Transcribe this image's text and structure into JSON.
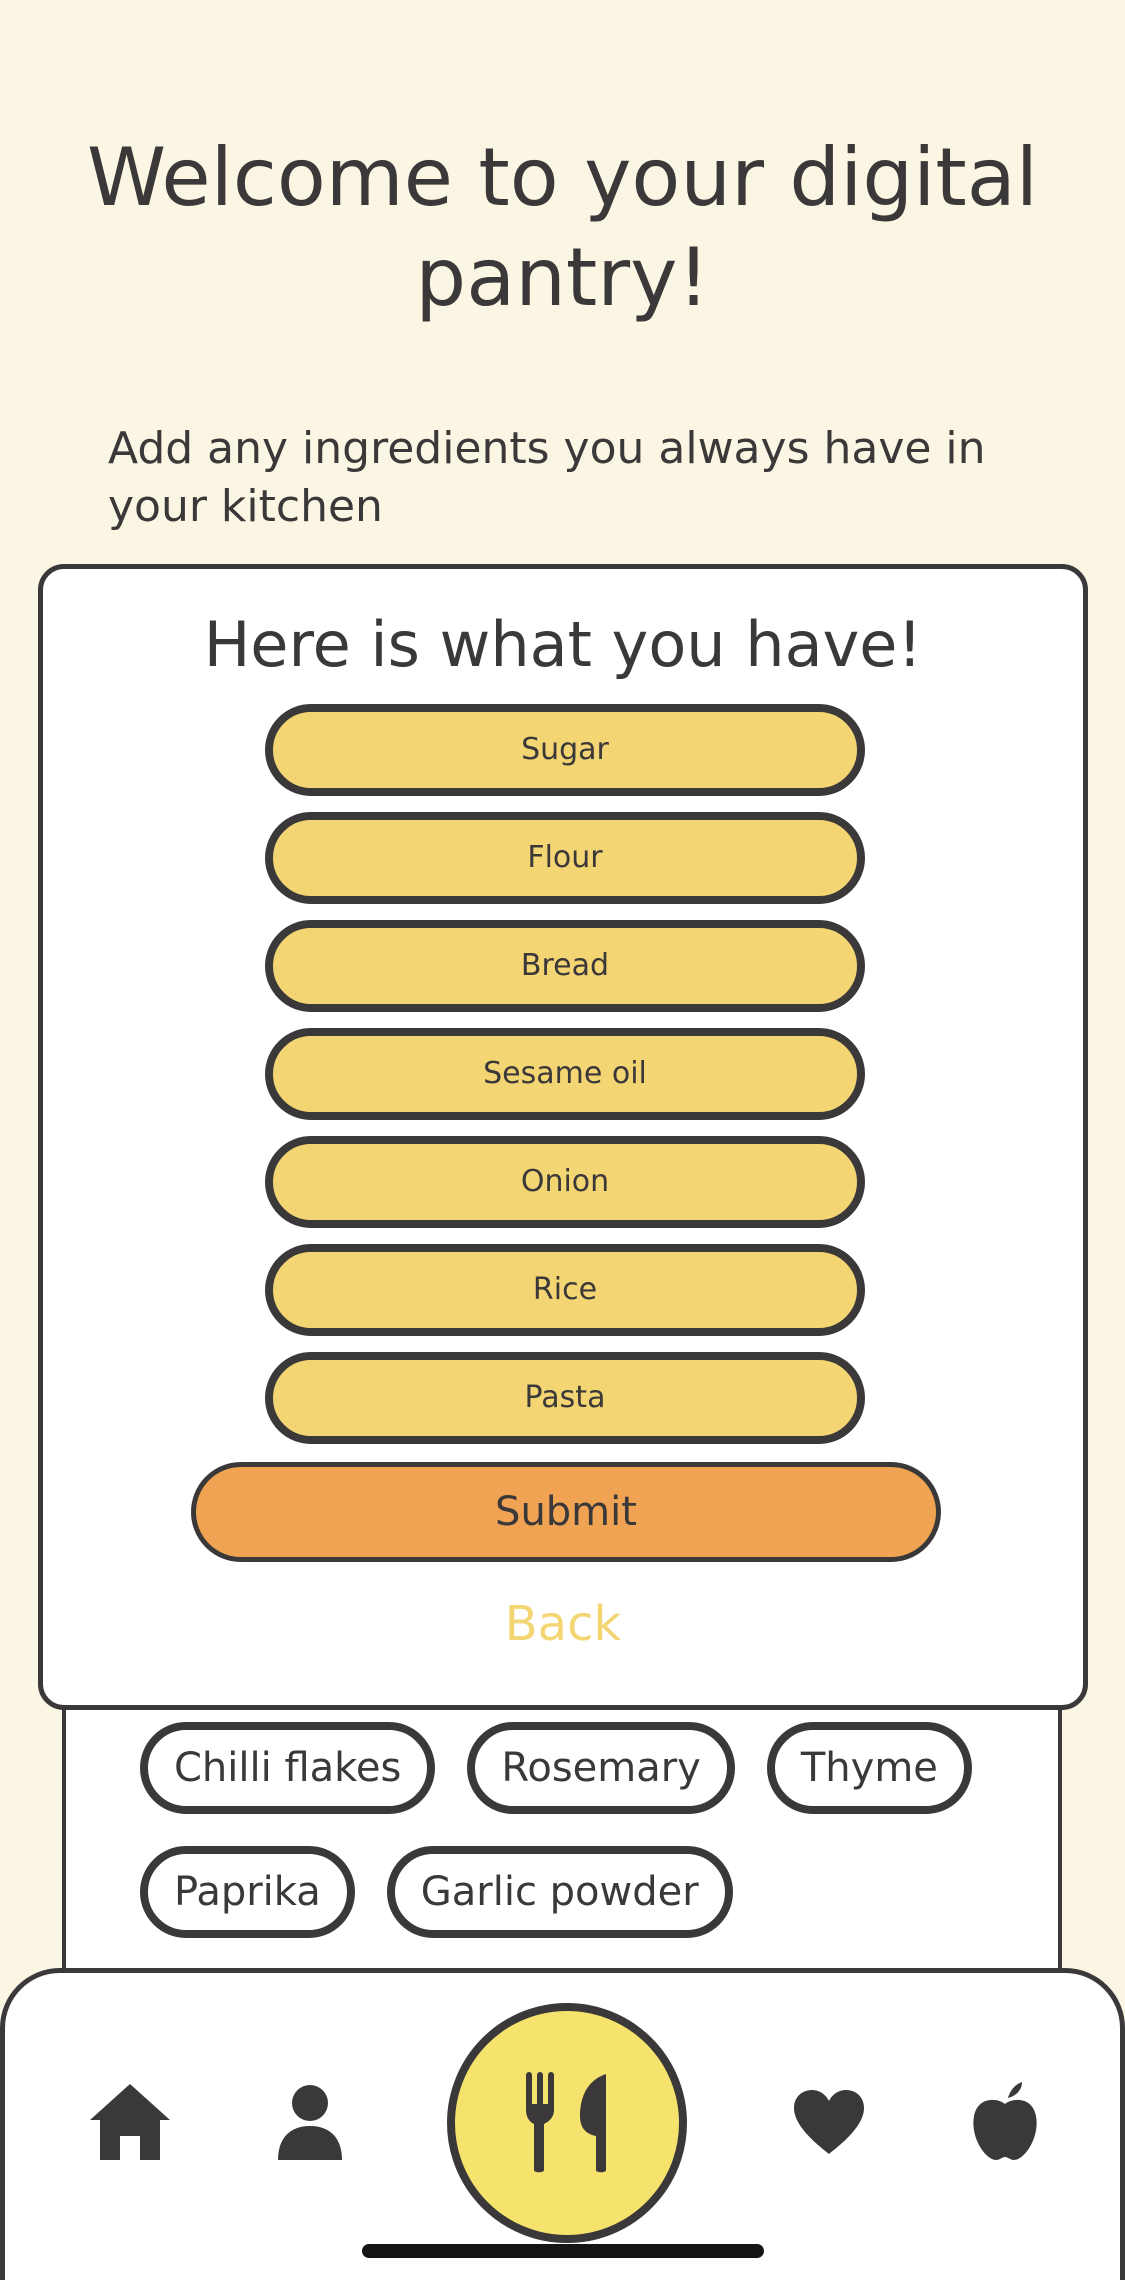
{
  "header": {
    "title_line1": "Welcome to your digital",
    "title_line2": "pantry!",
    "subtitle": "Add any ingredients you always have in your kitchen"
  },
  "card": {
    "title": "Here is what you have!",
    "items": [
      "Sugar",
      "Flour",
      "Bread",
      "Sesame oil",
      "Onion",
      "Rice",
      "Pasta"
    ],
    "submit_label": "Submit",
    "back_label": "Back"
  },
  "background_chips": [
    "Chilli flakes",
    "Rosemary",
    "Thyme",
    "Paprika",
    "Garlic powder"
  ],
  "nav": {
    "icons": [
      "home-icon",
      "user-icon",
      "fork-knife-icon",
      "heart-icon",
      "apple-icon"
    ]
  },
  "colors": {
    "background": "#fbf6e3",
    "item_fill": "#f4d573",
    "submit_fill": "#f0a352",
    "nav_center_fill": "#f6e36e",
    "text": "#3a3838"
  }
}
